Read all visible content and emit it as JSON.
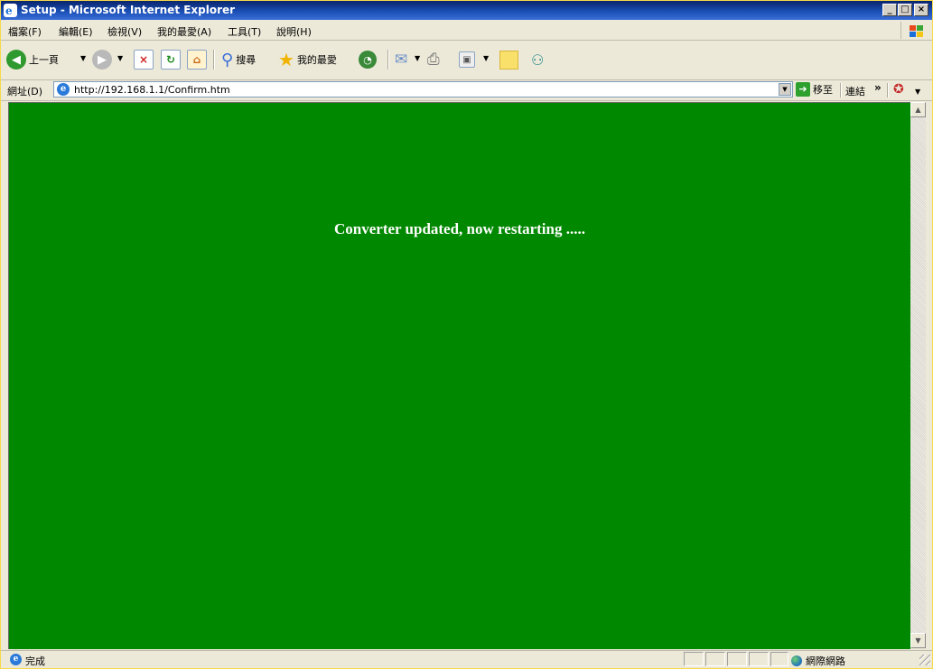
{
  "window": {
    "title": "Setup - Microsoft Internet Explorer"
  },
  "menu": [
    "檔案(F)",
    "編輯(E)",
    "檢視(V)",
    "我的最愛(A)",
    "工具(T)",
    "說明(H)"
  ],
  "toolbar": {
    "back_label": "上一頁",
    "search_label": "搜尋",
    "favorites_label": "我的最愛"
  },
  "address": {
    "label": "網址(D)",
    "url": "http://192.168.1.1/Confirm.htm",
    "go_label": "移至",
    "links_label": "連結"
  },
  "content": {
    "message": "Converter updated, now restarting .....",
    "background_color": "#008800"
  },
  "status": {
    "text": "完成",
    "zone": "網際網路"
  },
  "icons": [
    "ie-logo-icon",
    "windows-logo-icon",
    "back-icon",
    "forward-icon",
    "stop-icon",
    "refresh-icon",
    "home-icon",
    "search-icon",
    "favorites-icon",
    "history-icon",
    "mail-icon",
    "print-icon",
    "edit-icon",
    "notes-icon",
    "messenger-icon",
    "go-icon",
    "globe-icon"
  ]
}
